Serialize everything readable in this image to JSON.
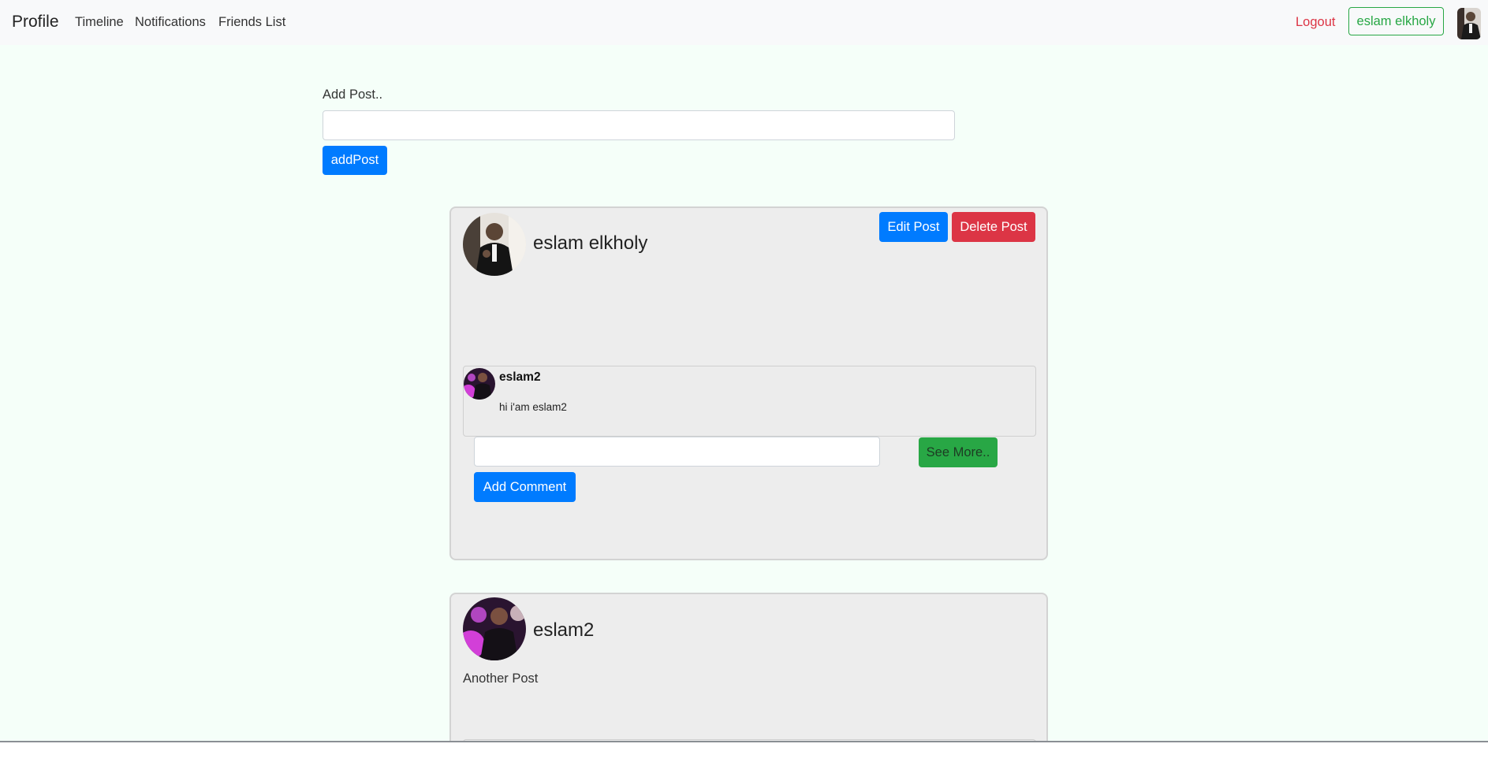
{
  "navbar": {
    "brand": "Profile",
    "links": [
      "Timeline",
      "Notifications",
      "Friends List"
    ],
    "logout": "Logout",
    "user_button": "eslam elkholy"
  },
  "add_post": {
    "label": "Add Post..",
    "input_value": "",
    "button": "addPost"
  },
  "posts": [
    {
      "author": "eslam elkholy",
      "text": "",
      "edit_label": "Edit Post",
      "delete_label": "Delete Post",
      "comments": [
        {
          "author": "eslam2",
          "text": "hi i'am eslam2"
        }
      ],
      "comment_input_value": "",
      "see_more_label": "See More..",
      "add_comment_label": "Add Comment"
    },
    {
      "author": "eslam2",
      "text": "Another Post"
    }
  ],
  "colors": {
    "page_background": "#f5fff9",
    "primary": "#007bff",
    "danger": "#dc3545",
    "success": "#28a745",
    "card_background": "#ededed"
  },
  "icons": {
    "nav_avatar": "user-photo-avatar",
    "post_avatar": "user-photo-avatar"
  }
}
